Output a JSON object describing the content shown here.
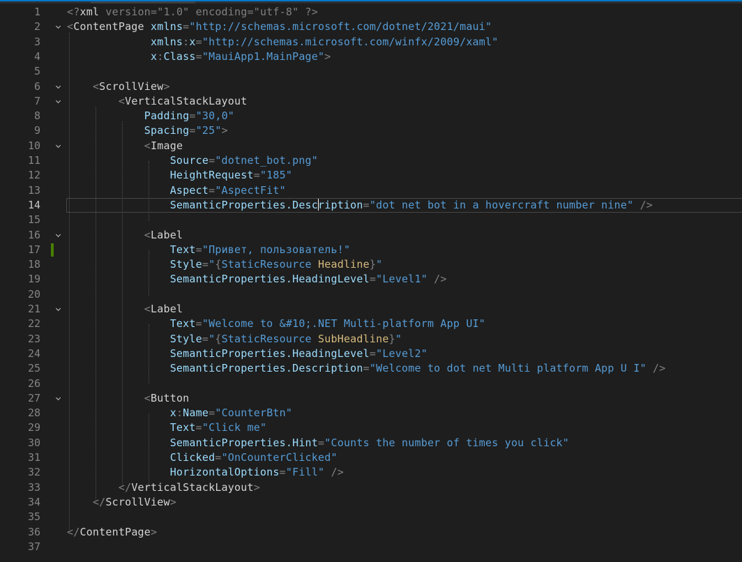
{
  "editor": {
    "language": "xaml",
    "current_line": 14,
    "changed_lines": [
      17
    ],
    "foldable_lines": [
      2,
      6,
      7,
      10,
      16,
      21,
      27
    ],
    "lines": [
      {
        "n": "1",
        "indent": "",
        "tokens": [
          [
            "punc",
            "<?"
          ],
          [
            "tag",
            "xml"
          ],
          [
            "punc",
            " version=\"1.0\" encoding=\"utf-8\" ?>"
          ]
        ]
      },
      {
        "n": "2",
        "indent": "",
        "tokens": [
          [
            "punc",
            "<"
          ],
          [
            "tag",
            "ContentPage"
          ],
          [
            "text",
            " "
          ],
          [
            "attr",
            "xmlns"
          ],
          [
            "punc",
            "="
          ],
          [
            "val",
            "\"http://schemas.microsoft.com/dotnet/2021/maui\""
          ]
        ]
      },
      {
        "n": "3",
        "indent": "             ",
        "tokens": [
          [
            "attr",
            "xmlns"
          ],
          [
            "punc",
            ":"
          ],
          [
            "attr",
            "x"
          ],
          [
            "punc",
            "="
          ],
          [
            "val",
            "\"http://schemas.microsoft.com/winfx/2009/xaml\""
          ]
        ]
      },
      {
        "n": "4",
        "indent": "             ",
        "tokens": [
          [
            "attr",
            "x"
          ],
          [
            "punc",
            ":"
          ],
          [
            "attr",
            "Class"
          ],
          [
            "punc",
            "="
          ],
          [
            "val",
            "\"MauiApp1.MainPage\""
          ],
          [
            "punc",
            ">"
          ]
        ]
      },
      {
        "n": "5",
        "indent": "",
        "tokens": []
      },
      {
        "n": "6",
        "indent": "    ",
        "tokens": [
          [
            "punc",
            "<"
          ],
          [
            "tag",
            "ScrollView"
          ],
          [
            "punc",
            ">"
          ]
        ]
      },
      {
        "n": "7",
        "indent": "        ",
        "tokens": [
          [
            "punc",
            "<"
          ],
          [
            "tag",
            "VerticalStackLayout"
          ]
        ]
      },
      {
        "n": "8",
        "indent": "            ",
        "tokens": [
          [
            "attr",
            "Padding"
          ],
          [
            "punc",
            "="
          ],
          [
            "val",
            "\"30,0\""
          ]
        ]
      },
      {
        "n": "9",
        "indent": "            ",
        "tokens": [
          [
            "attr",
            "Spacing"
          ],
          [
            "punc",
            "="
          ],
          [
            "val",
            "\"25\""
          ],
          [
            "punc",
            ">"
          ]
        ]
      },
      {
        "n": "10",
        "indent": "            ",
        "tokens": [
          [
            "punc",
            "<"
          ],
          [
            "tag",
            "Image"
          ]
        ]
      },
      {
        "n": "11",
        "indent": "                ",
        "tokens": [
          [
            "attr",
            "Source"
          ],
          [
            "punc",
            "="
          ],
          [
            "val",
            "\"dotnet_bot.png\""
          ]
        ]
      },
      {
        "n": "12",
        "indent": "                ",
        "tokens": [
          [
            "attr",
            "HeightRequest"
          ],
          [
            "punc",
            "="
          ],
          [
            "val",
            "\"185\""
          ]
        ]
      },
      {
        "n": "13",
        "indent": "                ",
        "tokens": [
          [
            "attr",
            "Aspect"
          ],
          [
            "punc",
            "="
          ],
          [
            "val",
            "\"AspectFit\""
          ]
        ]
      },
      {
        "n": "14",
        "indent": "                ",
        "tokens": [
          [
            "attr",
            "SemanticProperties.Desc"
          ],
          [
            "caret",
            ""
          ],
          [
            "attr",
            "ription"
          ],
          [
            "punc",
            "="
          ],
          [
            "val",
            "\"dot net bot in a hovercraft number nine\""
          ],
          [
            "punc",
            " />"
          ]
        ]
      },
      {
        "n": "15",
        "indent": "",
        "tokens": []
      },
      {
        "n": "16",
        "indent": "            ",
        "tokens": [
          [
            "punc",
            "<"
          ],
          [
            "tag",
            "Label"
          ]
        ]
      },
      {
        "n": "17",
        "indent": "                ",
        "tokens": [
          [
            "attr",
            "Text"
          ],
          [
            "punc",
            "="
          ],
          [
            "val",
            "\"Привет, пользователь!\""
          ]
        ]
      },
      {
        "n": "18",
        "indent": "                ",
        "tokens": [
          [
            "attr",
            "Style"
          ],
          [
            "punc",
            "="
          ],
          [
            "val",
            "\""
          ],
          [
            "punc",
            "{"
          ],
          [
            "val",
            "StaticResource "
          ],
          [
            "ext",
            "Headline"
          ],
          [
            "punc",
            "}"
          ],
          [
            "val",
            "\""
          ]
        ]
      },
      {
        "n": "19",
        "indent": "                ",
        "tokens": [
          [
            "attr",
            "SemanticProperties.HeadingLevel"
          ],
          [
            "punc",
            "="
          ],
          [
            "val",
            "\"Level1\""
          ],
          [
            "punc",
            " />"
          ]
        ]
      },
      {
        "n": "20",
        "indent": "",
        "tokens": []
      },
      {
        "n": "21",
        "indent": "            ",
        "tokens": [
          [
            "punc",
            "<"
          ],
          [
            "tag",
            "Label"
          ]
        ]
      },
      {
        "n": "22",
        "indent": "                ",
        "tokens": [
          [
            "attr",
            "Text"
          ],
          [
            "punc",
            "="
          ],
          [
            "val",
            "\"Welcome to &#10;.NET Multi-platform App UI\""
          ]
        ]
      },
      {
        "n": "23",
        "indent": "                ",
        "tokens": [
          [
            "attr",
            "Style"
          ],
          [
            "punc",
            "="
          ],
          [
            "val",
            "\""
          ],
          [
            "punc",
            "{"
          ],
          [
            "val",
            "StaticResource "
          ],
          [
            "ext",
            "SubHeadline"
          ],
          [
            "punc",
            "}"
          ],
          [
            "val",
            "\""
          ]
        ]
      },
      {
        "n": "24",
        "indent": "                ",
        "tokens": [
          [
            "attr",
            "SemanticProperties.HeadingLevel"
          ],
          [
            "punc",
            "="
          ],
          [
            "val",
            "\"Level2\""
          ]
        ]
      },
      {
        "n": "25",
        "indent": "                ",
        "tokens": [
          [
            "attr",
            "SemanticProperties.Description"
          ],
          [
            "punc",
            "="
          ],
          [
            "val",
            "\"Welcome to dot net Multi platform App U I\""
          ],
          [
            "punc",
            " />"
          ]
        ]
      },
      {
        "n": "26",
        "indent": "",
        "tokens": []
      },
      {
        "n": "27",
        "indent": "            ",
        "tokens": [
          [
            "punc",
            "<"
          ],
          [
            "tag",
            "Button"
          ]
        ]
      },
      {
        "n": "28",
        "indent": "                ",
        "tokens": [
          [
            "attr",
            "x"
          ],
          [
            "punc",
            ":"
          ],
          [
            "attr",
            "Name"
          ],
          [
            "punc",
            "="
          ],
          [
            "val",
            "\"CounterBtn\""
          ]
        ]
      },
      {
        "n": "29",
        "indent": "                ",
        "tokens": [
          [
            "attr",
            "Text"
          ],
          [
            "punc",
            "="
          ],
          [
            "val",
            "\"Click me\""
          ]
        ]
      },
      {
        "n": "30",
        "indent": "                ",
        "tokens": [
          [
            "attr",
            "SemanticProperties.Hint"
          ],
          [
            "punc",
            "="
          ],
          [
            "val",
            "\"Counts the number of times you click\""
          ]
        ]
      },
      {
        "n": "31",
        "indent": "                ",
        "tokens": [
          [
            "attr",
            "Clicked"
          ],
          [
            "punc",
            "="
          ],
          [
            "val",
            "\"OnCounterClicked\""
          ]
        ]
      },
      {
        "n": "32",
        "indent": "                ",
        "tokens": [
          [
            "attr",
            "HorizontalOptions"
          ],
          [
            "punc",
            "="
          ],
          [
            "val",
            "\"Fill\""
          ],
          [
            "punc",
            " />"
          ]
        ]
      },
      {
        "n": "33",
        "indent": "        ",
        "tokens": [
          [
            "punc",
            "</"
          ],
          [
            "tag",
            "VerticalStackLayout"
          ],
          [
            "punc",
            ">"
          ]
        ]
      },
      {
        "n": "34",
        "indent": "    ",
        "tokens": [
          [
            "punc",
            "</"
          ],
          [
            "tag",
            "ScrollView"
          ],
          [
            "punc",
            ">"
          ]
        ]
      },
      {
        "n": "35",
        "indent": "",
        "tokens": []
      },
      {
        "n": "36",
        "indent": "",
        "tokens": [
          [
            "punc",
            "</"
          ],
          [
            "tag",
            "ContentPage"
          ],
          [
            "punc",
            ">"
          ]
        ]
      },
      {
        "n": "37",
        "indent": "",
        "tokens": []
      }
    ]
  }
}
